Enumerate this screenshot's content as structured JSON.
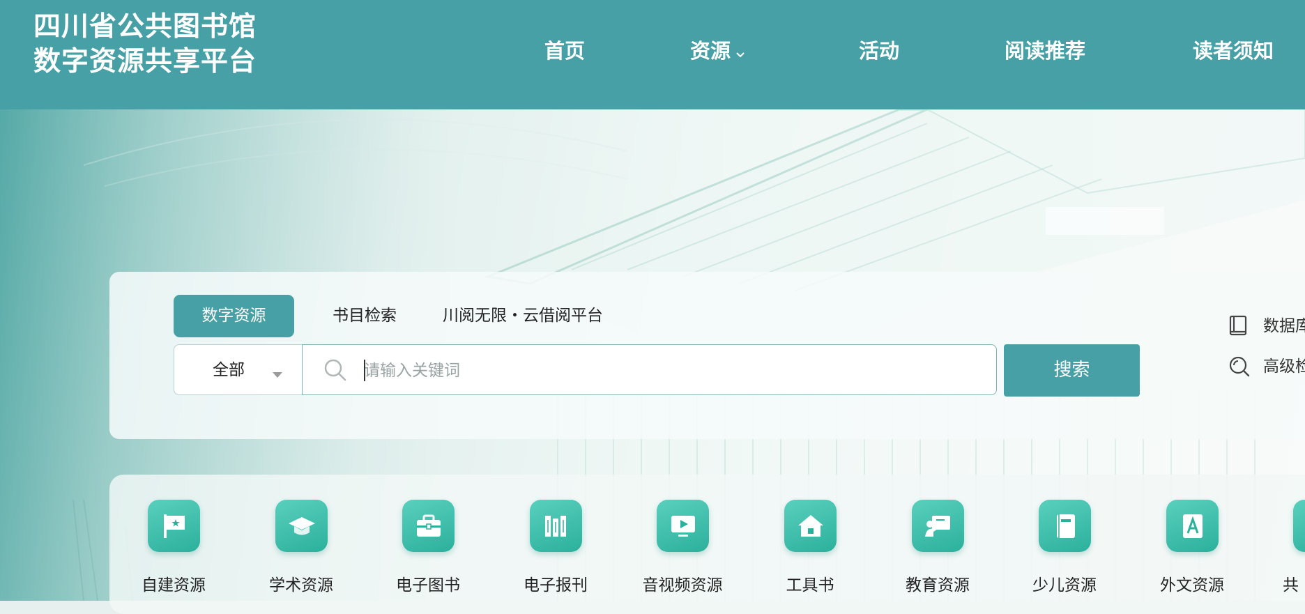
{
  "header": {
    "brand_line1": "四川省公共图书馆",
    "brand_line2": "数字资源共享平台",
    "nav": [
      {
        "label": "首页"
      },
      {
        "label": "资源",
        "has_dropdown": true
      },
      {
        "label": "活动"
      },
      {
        "label": "阅读推荐"
      },
      {
        "label": "读者须知"
      }
    ]
  },
  "search": {
    "tabs": [
      {
        "label": "数字资源",
        "active": true
      },
      {
        "label": "书目检索",
        "active": false
      },
      {
        "label": "川阅无限・云借阅平台",
        "active": false
      }
    ],
    "scope_value": "全部",
    "placeholder": "请输入关键词",
    "button_label": "搜索",
    "side_links": [
      {
        "label": "数据库",
        "icon": "book-icon"
      },
      {
        "label": "高级检",
        "icon": "advanced-search-icon"
      }
    ]
  },
  "categories": [
    {
      "label": "自建资源",
      "icon": "flag-icon"
    },
    {
      "label": "学术资源",
      "icon": "graduation-cap-icon"
    },
    {
      "label": "电子图书",
      "icon": "briefcase-icon"
    },
    {
      "label": "电子报刊",
      "icon": "bookshelf-icon"
    },
    {
      "label": "音视频资源",
      "icon": "video-icon"
    },
    {
      "label": "工具书",
      "icon": "home-icon"
    },
    {
      "label": "教育资源",
      "icon": "teacher-board-icon"
    },
    {
      "label": "少儿资源",
      "icon": "notebook-icon"
    },
    {
      "label": "外文资源",
      "icon": "letter-a-icon"
    },
    {
      "label": "共"
    }
  ],
  "colors": {
    "header_bg": "#46a0a5",
    "accent": "#46a0a5",
    "category_icon": "#2bb09c"
  }
}
